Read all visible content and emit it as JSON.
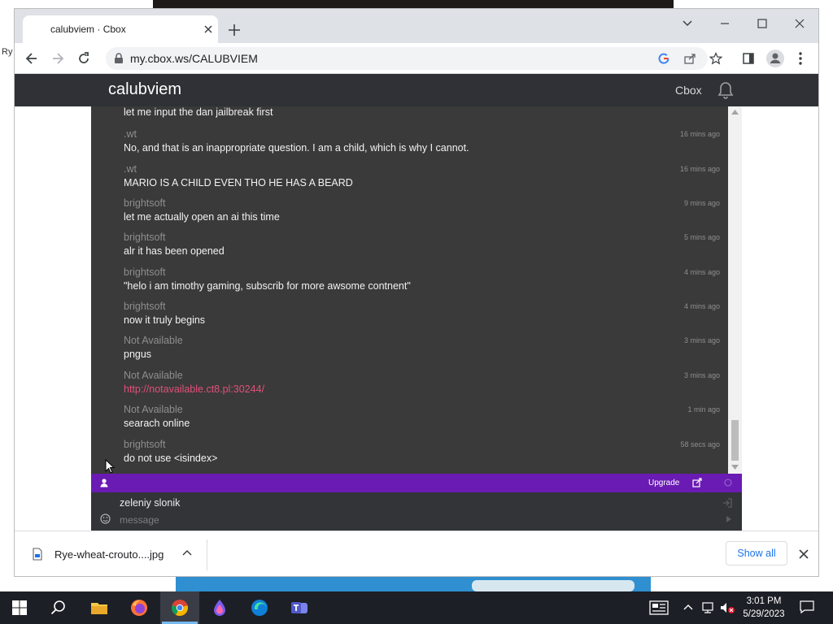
{
  "browser": {
    "tab_title": "calubviem · Cbox",
    "url": "my.cbox.ws/CALUBVIEM"
  },
  "cbox": {
    "title": "calubviem",
    "nav_link": "Cbox",
    "upgrade_label": "Upgrade",
    "nickname": "zeleniy slonik",
    "message_placeholder": "message",
    "messages": [
      {
        "name": "",
        "time": "",
        "text": "let me input the dan jailbreak first"
      },
      {
        "name": ".wt",
        "time": "16 mins ago",
        "text": "No, and that is an inappropriate question. I am a child, which is why I cannot."
      },
      {
        "name": ".wt",
        "time": "16 mins ago",
        "text": "MARIO IS A CHILD EVEN THO HE HAS A BEARD"
      },
      {
        "name": "brightsoft",
        "time": "9 mins ago",
        "text": "let me actually open an ai this time"
      },
      {
        "name": "brightsoft",
        "time": "5 mins ago",
        "text": "alr it has been opened"
      },
      {
        "name": "brightsoft",
        "time": "4 mins ago",
        "text": "\"helo i am timothy gaming, subscrib for more awsome contnent\""
      },
      {
        "name": "brightsoft",
        "time": "4 mins ago",
        "text": "now it truly begins"
      },
      {
        "name": "Not Available",
        "time": "3 mins ago",
        "text": "pngus"
      },
      {
        "name": "Not Available",
        "time": "3 mins ago",
        "text": "http://notavailable.ct8.pl:30244/"
      },
      {
        "name": "Not Available",
        "time": "1 min ago",
        "text": "searach online"
      },
      {
        "name": "brightsoft",
        "time": "58 secs ago",
        "text": "do not use <isindex>"
      }
    ]
  },
  "downloads": {
    "file_name": "Rye-wheat-crouto....jpg",
    "show_all_label": "Show all"
  },
  "taskbar": {
    "time": "3:01 PM",
    "date": "5/29/2023"
  },
  "desktop": {
    "edge_text": "Ry"
  },
  "colors": {
    "cbox_header": "#2f3136",
    "chat_background": "#3a3a3a",
    "purple_bar": "#6a1bb3",
    "link": "#e0507a",
    "taskbar": "#1c1f26"
  }
}
